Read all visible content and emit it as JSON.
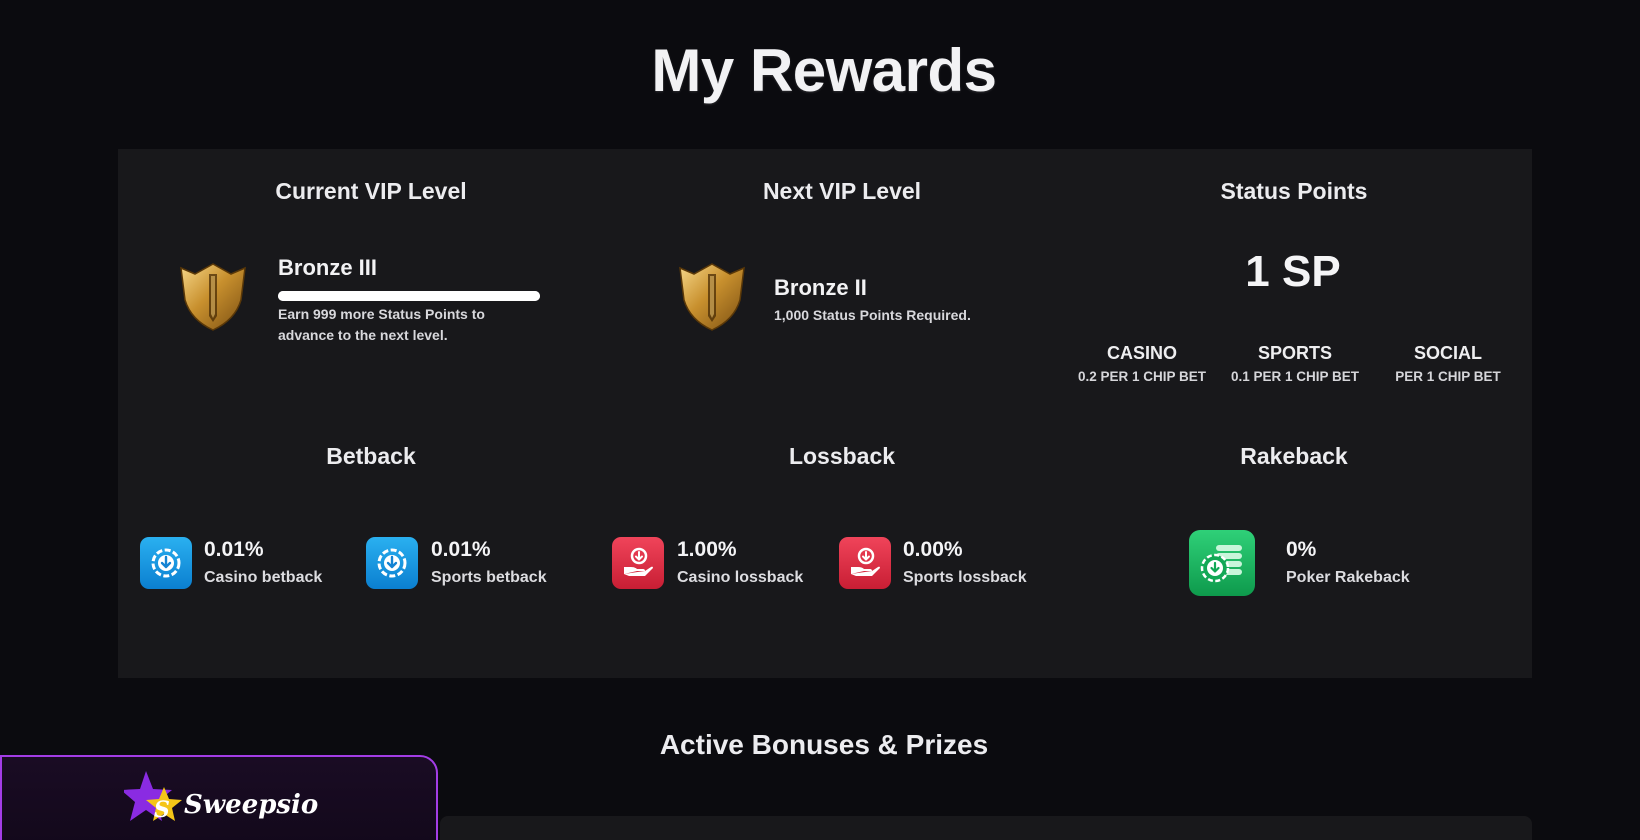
{
  "page": {
    "title": "My Rewards"
  },
  "current_vip": {
    "section_title": "Current VIP Level",
    "level_name": "Bronze III",
    "progress_fraction": 1.0,
    "message": "Earn 999 more Status Points to advance to the next level.",
    "icon": "shield-icon"
  },
  "next_vip": {
    "section_title": "Next VIP Level",
    "level_name": "Bronze II",
    "requirement": "1,000 Status Points Required.",
    "icon": "shield-icon"
  },
  "status_points": {
    "section_title": "Status Points",
    "value": "1 SP",
    "columns": [
      {
        "name": "CASINO",
        "rate": "0.2 PER 1 CHIP BET"
      },
      {
        "name": "SPORTS",
        "rate": "0.1 PER 1 CHIP BET"
      },
      {
        "name": "SOCIAL",
        "rate": "PER 1 CHIP BET"
      }
    ]
  },
  "betback": {
    "section_title": "Betback",
    "items": [
      {
        "value": "0.01%",
        "label": "Casino betback",
        "icon": "betback-download-icon"
      },
      {
        "value": "0.01%",
        "label": "Sports betback",
        "icon": "betback-download-icon"
      }
    ],
    "color": "#1a98e6"
  },
  "lossback": {
    "section_title": "Lossback",
    "items": [
      {
        "value": "1.00%",
        "label": "Casino lossback",
        "icon": "lossback-hand-icon"
      },
      {
        "value": "0.00%",
        "label": "Sports lossback",
        "icon": "lossback-hand-icon"
      }
    ],
    "color": "#e0303f"
  },
  "rakeback": {
    "section_title": "Rakeback",
    "items": [
      {
        "value": "0%",
        "label": "Poker Rakeback",
        "icon": "rakeback-chips-icon"
      }
    ],
    "color": "#1fb862"
  },
  "bonuses": {
    "section_title": "Active Bonuses & Prizes"
  },
  "brand": {
    "name": "Sweepsio",
    "icon": "star-logo-icon",
    "accent": "#a33de6"
  }
}
